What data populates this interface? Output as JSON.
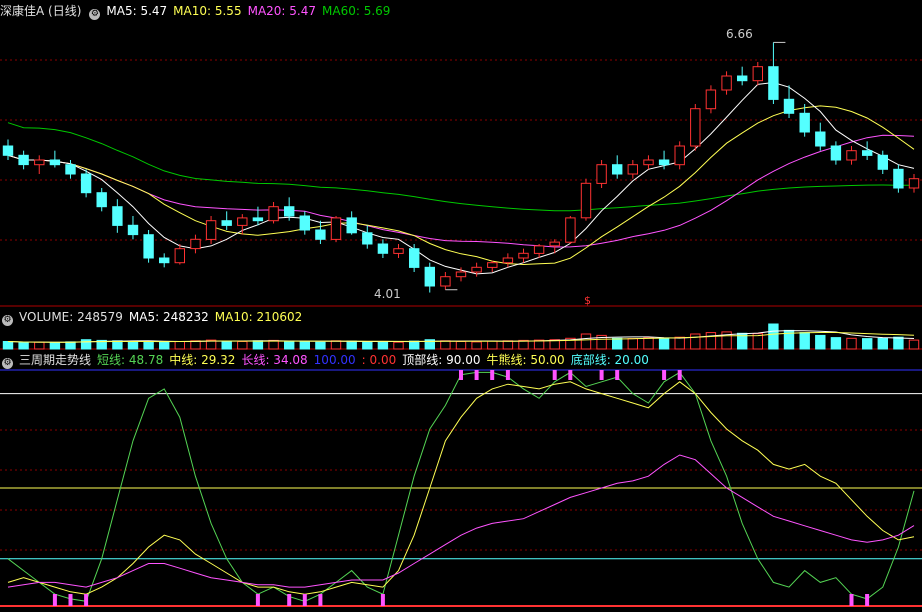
{
  "price_panel": {
    "title": "深康佳A (日线)",
    "ma5": "MA5: 5.47",
    "ma10": "MA10: 5.55",
    "ma20": "MA20: 5.47",
    "ma60": "MA60: 5.69",
    "high_label": "6.66",
    "low_label": "4.01",
    "signal_mark": "$"
  },
  "volume_panel": {
    "volume": "VOLUME: 248579",
    "ma5": "MA5: 248232",
    "ma10": "MA10: 210602"
  },
  "indicator_panel": {
    "name": "三周期走势线",
    "short": "短线: 48.78",
    "mid": "中线: 29.32",
    "long": "长线: 34.08",
    "v100": "100.00",
    "v0": ": 0.00",
    "top": "顶部线: 90.00",
    "bull": "牛熊线: 50.00",
    "bottom": "底部线: 20.00"
  },
  "colors": {
    "up": "#ff3232",
    "down": "#54ffff",
    "ma5": "#ffffff",
    "ma10": "#ffff54",
    "ma20": "#ff54ff",
    "ma60": "#00c800",
    "grid": "#8b0000",
    "short": "#54d454",
    "mid": "#ffff54",
    "long": "#ff54ff"
  },
  "chart_data": [
    {
      "type": "candlestick",
      "title": "深康佳A (日线)",
      "ylim": [
        3.9,
        6.9
      ],
      "annotations": [
        {
          "label": "6.66",
          "value": 6.66
        },
        {
          "label": "4.01",
          "value": 4.01
        }
      ],
      "candles": [
        [
          5.55,
          5.62,
          5.4,
          5.45
        ],
        [
          5.45,
          5.5,
          5.3,
          5.35
        ],
        [
          5.35,
          5.45,
          5.25,
          5.4
        ],
        [
          5.4,
          5.5,
          5.32,
          5.35
        ],
        [
          5.35,
          5.4,
          5.2,
          5.25
        ],
        [
          5.25,
          5.3,
          5.0,
          5.05
        ],
        [
          5.05,
          5.1,
          4.85,
          4.9
        ],
        [
          4.9,
          4.98,
          4.62,
          4.7
        ],
        [
          4.7,
          4.8,
          4.55,
          4.6
        ],
        [
          4.6,
          4.65,
          4.3,
          4.35
        ],
        [
          4.35,
          4.4,
          4.25,
          4.3
        ],
        [
          4.3,
          4.5,
          4.28,
          4.45
        ],
        [
          4.45,
          4.6,
          4.4,
          4.55
        ],
        [
          4.55,
          4.8,
          4.5,
          4.75
        ],
        [
          4.75,
          4.85,
          4.65,
          4.7
        ],
        [
          4.7,
          4.82,
          4.6,
          4.78
        ],
        [
          4.78,
          4.9,
          4.7,
          4.75
        ],
        [
          4.75,
          4.95,
          4.72,
          4.9
        ],
        [
          4.9,
          5.0,
          4.75,
          4.8
        ],
        [
          4.8,
          4.85,
          4.6,
          4.65
        ],
        [
          4.65,
          4.75,
          4.5,
          4.55
        ],
        [
          4.55,
          4.8,
          4.52,
          4.78
        ],
        [
          4.78,
          4.85,
          4.6,
          4.62
        ],
        [
          4.62,
          4.7,
          4.45,
          4.5
        ],
        [
          4.5,
          4.55,
          4.35,
          4.4
        ],
        [
          4.4,
          4.5,
          4.35,
          4.45
        ],
        [
          4.45,
          4.5,
          4.2,
          4.25
        ],
        [
          4.25,
          4.3,
          3.98,
          4.05
        ],
        [
          4.05,
          4.2,
          4.01,
          4.15
        ],
        [
          4.15,
          4.25,
          4.1,
          4.2
        ],
        [
          4.2,
          4.3,
          4.15,
          4.25
        ],
        [
          4.25,
          4.32,
          4.2,
          4.3
        ],
        [
          4.3,
          4.4,
          4.25,
          4.35
        ],
        [
          4.35,
          4.45,
          4.3,
          4.4
        ],
        [
          4.4,
          4.5,
          4.35,
          4.48
        ],
        [
          4.48,
          4.55,
          4.4,
          4.52
        ],
        [
          4.52,
          4.8,
          4.5,
          4.78
        ],
        [
          4.78,
          5.2,
          4.75,
          5.15
        ],
        [
          5.15,
          5.4,
          5.1,
          5.35
        ],
        [
          5.35,
          5.45,
          5.2,
          5.25
        ],
        [
          5.25,
          5.4,
          5.2,
          5.35
        ],
        [
          5.35,
          5.45,
          5.3,
          5.4
        ],
        [
          5.4,
          5.5,
          5.3,
          5.35
        ],
        [
          5.35,
          5.6,
          5.3,
          5.55
        ],
        [
          5.55,
          6.0,
          5.5,
          5.95
        ],
        [
          5.95,
          6.2,
          5.9,
          6.15
        ],
        [
          6.15,
          6.35,
          6.1,
          6.3
        ],
        [
          6.3,
          6.4,
          6.2,
          6.25
        ],
        [
          6.25,
          6.45,
          6.2,
          6.4
        ],
        [
          6.4,
          6.66,
          6.0,
          6.05
        ],
        [
          6.05,
          6.2,
          5.85,
          5.9
        ],
        [
          5.9,
          6.0,
          5.65,
          5.7
        ],
        [
          5.7,
          5.8,
          5.5,
          5.55
        ],
        [
          5.55,
          5.6,
          5.35,
          5.4
        ],
        [
          5.4,
          5.55,
          5.35,
          5.5
        ],
        [
          5.5,
          5.6,
          5.4,
          5.45
        ],
        [
          5.45,
          5.5,
          5.25,
          5.3
        ],
        [
          5.3,
          5.35,
          5.05,
          5.1
        ],
        [
          5.1,
          5.25,
          5.05,
          5.2
        ]
      ]
    },
    {
      "type": "bar",
      "title": "VOLUME",
      "values": [
        210,
        180,
        190,
        170,
        200,
        260,
        240,
        230,
        200,
        220,
        190,
        210,
        230,
        250,
        220,
        210,
        230,
        240,
        220,
        200,
        190,
        230,
        220,
        210,
        200,
        190,
        220,
        260,
        230,
        210,
        200,
        220,
        230,
        240,
        250,
        260,
        300,
        420,
        380,
        300,
        290,
        310,
        300,
        330,
        420,
        460,
        480,
        440,
        430,
        700,
        520,
        460,
        380,
        320,
        300,
        290,
        300,
        330,
        250
      ]
    },
    {
      "type": "line",
      "title": "三周期走势线",
      "ylim": [
        0,
        100
      ],
      "reference_lines": [
        {
          "label": "顶部线",
          "value": 90
        },
        {
          "label": "牛熊线",
          "value": 50
        },
        {
          "label": "底部线",
          "value": 20
        }
      ],
      "series": [
        {
          "name": "短线",
          "values": [
            20,
            15,
            10,
            5,
            3,
            2,
            20,
            45,
            70,
            88,
            92,
            80,
            55,
            35,
            20,
            10,
            5,
            8,
            4,
            2,
            5,
            10,
            15,
            8,
            5,
            30,
            55,
            75,
            85,
            98,
            99,
            99,
            97,
            92,
            88,
            95,
            99,
            93,
            95,
            97,
            90,
            86,
            95,
            99,
            90,
            70,
            55,
            35,
            20,
            10,
            8,
            15,
            10,
            12,
            5,
            3,
            8,
            25,
            48.78
          ]
        },
        {
          "name": "中线",
          "values": [
            10,
            12,
            10,
            8,
            6,
            5,
            8,
            12,
            18,
            25,
            30,
            28,
            22,
            18,
            14,
            10,
            8,
            8,
            6,
            5,
            6,
            8,
            10,
            9,
            8,
            15,
            30,
            50,
            70,
            80,
            88,
            92,
            94,
            93,
            92,
            94,
            95,
            92,
            90,
            88,
            86,
            84,
            90,
            95,
            90,
            82,
            75,
            70,
            66,
            60,
            58,
            60,
            55,
            52,
            45,
            38,
            32,
            28,
            29.32
          ]
        },
        {
          "name": "长线",
          "values": [
            8,
            9,
            10,
            10,
            9,
            8,
            10,
            12,
            15,
            18,
            18,
            16,
            14,
            12,
            11,
            10,
            9,
            9,
            8,
            8,
            9,
            10,
            11,
            11,
            11,
            14,
            18,
            22,
            26,
            30,
            33,
            35,
            36,
            37,
            40,
            43,
            46,
            48,
            50,
            52,
            53,
            55,
            60,
            64,
            62,
            56,
            50,
            46,
            42,
            38,
            36,
            34,
            32,
            30,
            28,
            27,
            28,
            30,
            34.08
          ]
        }
      ]
    }
  ]
}
